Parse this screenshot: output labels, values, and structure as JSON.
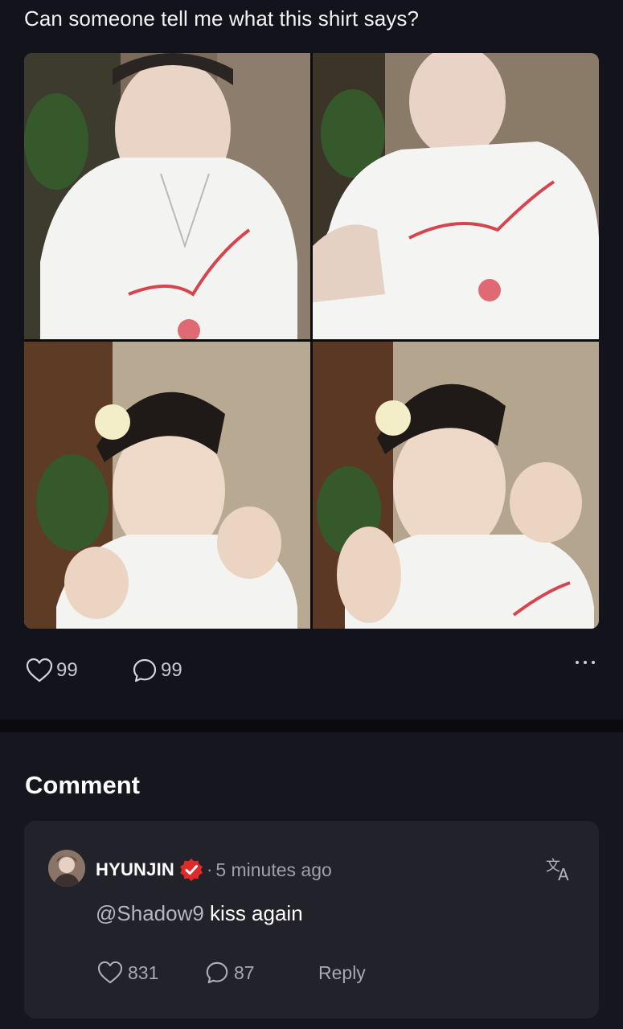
{
  "post": {
    "text": "Can someone tell me what this shirt says?",
    "photos": [
      {
        "alt": "photo-1"
      },
      {
        "alt": "photo-2"
      },
      {
        "alt": "photo-3"
      },
      {
        "alt": "photo-4"
      }
    ],
    "likes": "99",
    "comments": "99"
  },
  "comments_section": {
    "title": "Comment",
    "items": [
      {
        "username": "HYUNJIN",
        "separator": "·",
        "time": "5 minutes ago",
        "mention": "@Shadow9",
        "text": " kiss again",
        "likes": "831",
        "replies": "87",
        "reply_label": "Reply"
      }
    ]
  },
  "icons": {
    "like": "heart-icon",
    "comment": "speech-bubble-icon",
    "more": "more-dots-icon",
    "verified": "verified-badge-icon",
    "translate": "translate-icon"
  },
  "colors": {
    "background": "#111118",
    "card": "#22222b",
    "verified_badge": "#e02a2a",
    "muted_text": "#a0a0aa"
  }
}
